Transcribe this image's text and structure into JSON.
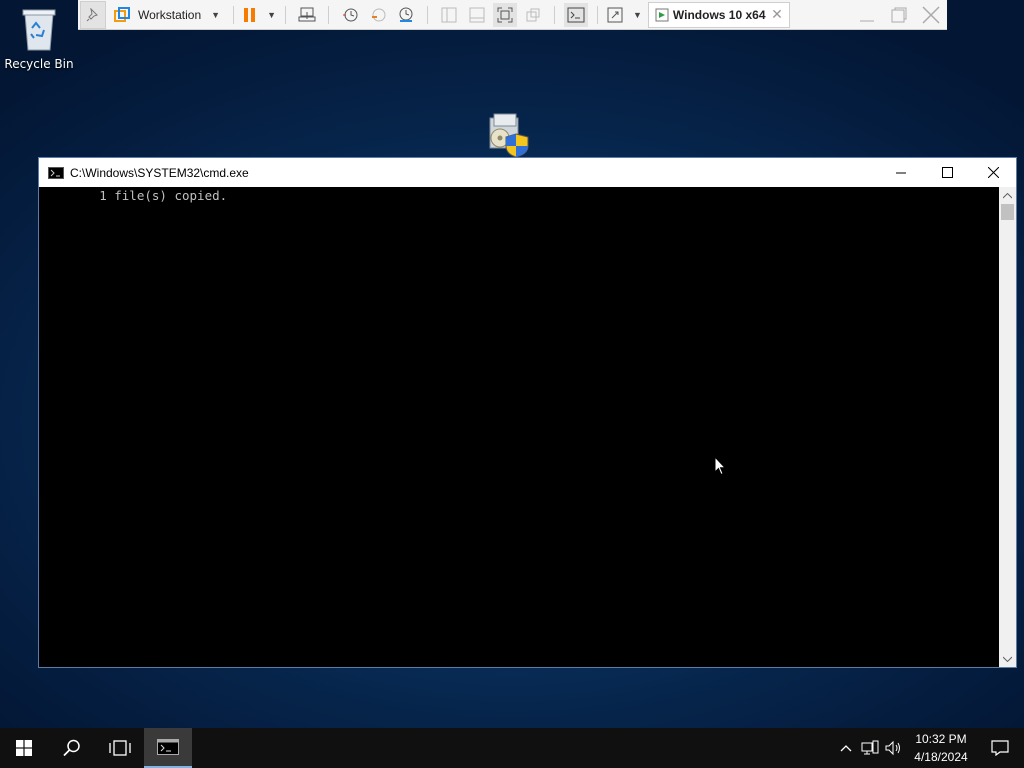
{
  "desktop": {
    "icons": [
      {
        "label": "Recycle Bin"
      }
    ]
  },
  "vmware_toolbar": {
    "workstation_label": "Workstation",
    "vm_tab_label": "Windows 10 x64"
  },
  "cmd_window": {
    "title": "C:\\Windows\\SYSTEM32\\cmd.exe",
    "output_lines": [
      "        1 file(s) copied."
    ]
  },
  "taskbar": {
    "time": "10:32 PM",
    "date": "4/18/2024"
  },
  "colors": {
    "accent": "#0078d7",
    "pause_orange": "#f57c00",
    "cmd_text": "#c0c0c0"
  }
}
